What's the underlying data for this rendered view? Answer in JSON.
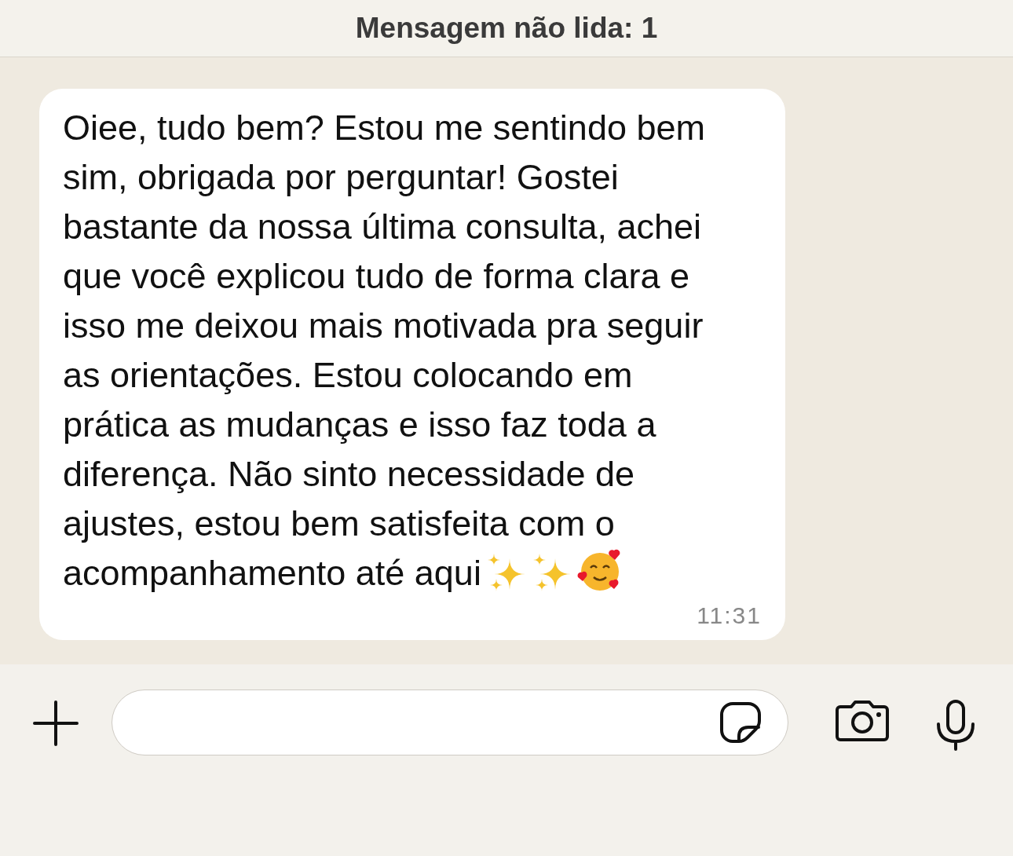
{
  "header": {
    "title": "Mensagem não lida: 1"
  },
  "messages": [
    {
      "lines": [
        "Oiee, tudo bem? Estou me sentindo bem",
        "sim, obrigada por perguntar! Gostei",
        "bastante da nossa última consulta, achei",
        "que você explicou tudo de forma clara e",
        "isso me deixou mais motivada pra seguir",
        "as orientações. Estou colocando em",
        "prática as mudanças e isso faz toda a",
        "diferença. Não sinto necessidade de",
        "ajustes, estou bem satisfeita com o",
        "acompanhamento até aqui"
      ],
      "time": "11:31"
    }
  ]
}
